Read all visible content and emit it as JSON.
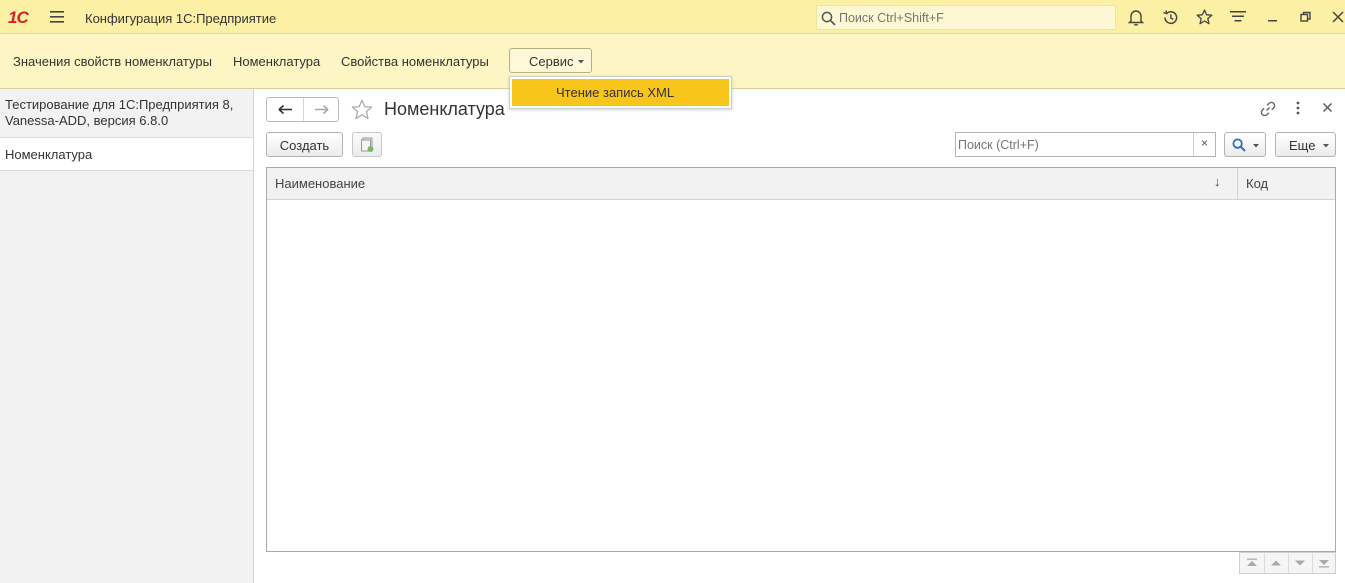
{
  "titlebar": {
    "logo": "1С",
    "title": "Конфигурация 1С:Предприятие",
    "search_placeholder": "Поиск Ctrl+Shift+F",
    "icons": [
      "menu-icon",
      "bell-icon",
      "history-icon",
      "star-icon",
      "settings-icon",
      "minimize-icon",
      "restore-icon",
      "close-icon"
    ]
  },
  "sections": {
    "items": [
      "Значения свойств номенклатуры",
      "Номенклатура",
      "Свойства номенклатуры"
    ],
    "service_label": "Сервис"
  },
  "dropdown": {
    "items": [
      "Чтение запись XML"
    ]
  },
  "leftpanel": {
    "header": "Тестирование для 1С:Предприятия 8, Vanessa-ADD, версия 6.8.0",
    "items": [
      "Номенклатура"
    ]
  },
  "form": {
    "title": "Номенклатура",
    "create_label": "Создать",
    "search_placeholder": "Поиск (Ctrl+F)",
    "clear_label": "×",
    "more_label": "Еще"
  },
  "table": {
    "columns": [
      "Наименование",
      "Код"
    ],
    "sort_indicator": "↓",
    "rows": []
  },
  "colors": {
    "titlebar_bg": "#fbf0a4",
    "sections_bg": "#fdf6c4",
    "highlight": "#f8c61a",
    "logo": "#d8202a",
    "search_icon_blue": "#2f6fbf"
  }
}
